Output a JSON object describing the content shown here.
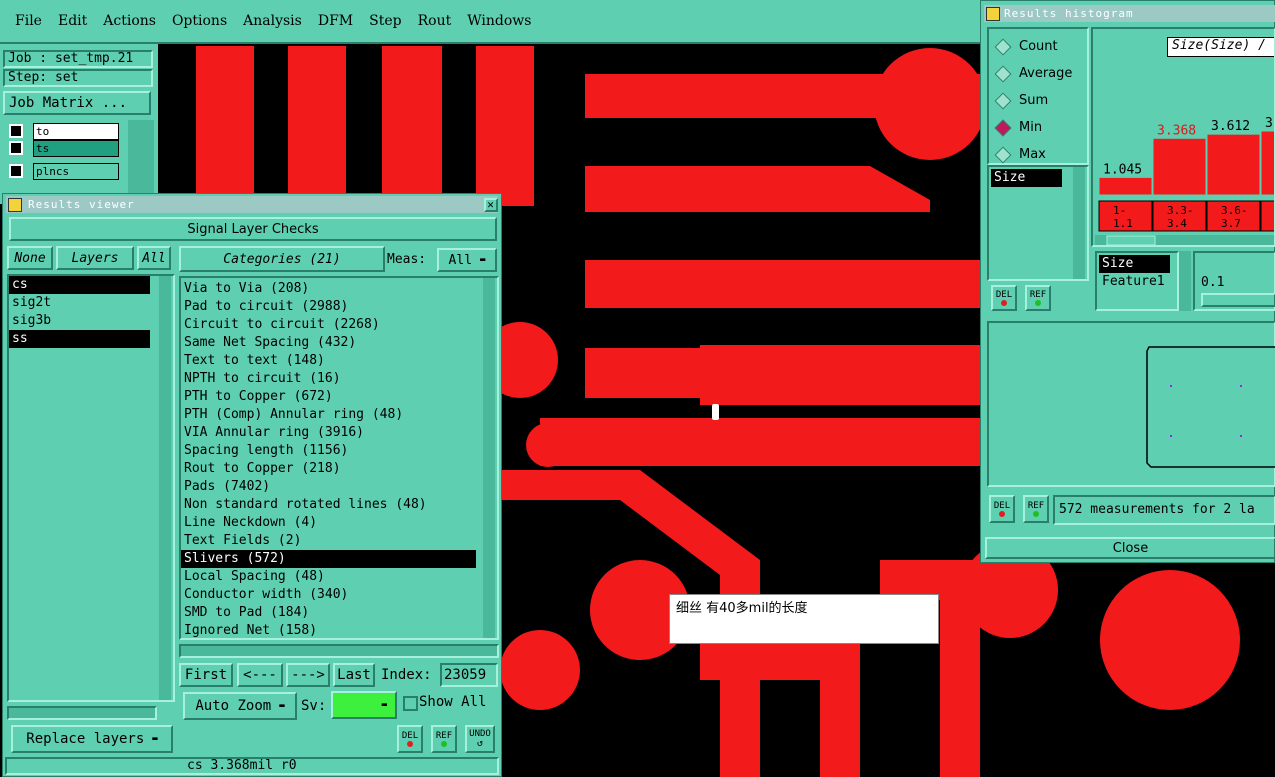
{
  "menu": [
    "File",
    "Edit",
    "Actions",
    "Options",
    "Analysis",
    "DFM",
    "Step",
    "Rout",
    "Windows"
  ],
  "job": {
    "job_label": "Job : set_tmp.21",
    "step_label": "Step: set",
    "matrix_button": "Job Matrix ..."
  },
  "layer_list": [
    {
      "name": "to",
      "color": "#ffffff"
    },
    {
      "name": "ts",
      "color": "#20a080"
    },
    {
      "name": "plncs",
      "color": "#5ecfb0"
    },
    {
      "name": "ss",
      "color": "#ffcc80"
    }
  ],
  "results_viewer": {
    "title": "Results viewer",
    "signal_checks": "Signal Layer Checks",
    "none_btn": "None",
    "layers_btn": "Layers",
    "all_btn": "All",
    "layers": [
      {
        "name": "cs",
        "selected": true
      },
      {
        "name": "sig2t",
        "selected": false
      },
      {
        "name": "sig3b",
        "selected": false
      },
      {
        "name": "ss",
        "selected": true
      }
    ],
    "categories_btn": "Categories (21)",
    "meas_label": "Meas:",
    "meas_value": "All",
    "categories": [
      {
        "label": "Via to Via (208)",
        "selected": false
      },
      {
        "label": "Pad to circuit (2988)",
        "selected": false
      },
      {
        "label": "Circuit to circuit (2268)",
        "selected": false
      },
      {
        "label": "Same Net Spacing (432)",
        "selected": false
      },
      {
        "label": "Text to text (148)",
        "selected": false
      },
      {
        "label": "NPTH to circuit (16)",
        "selected": false
      },
      {
        "label": "PTH to Copper (672)",
        "selected": false
      },
      {
        "label": "PTH (Comp) Annular ring (48)",
        "selected": false
      },
      {
        "label": "VIA Annular ring (3916)",
        "selected": false
      },
      {
        "label": "Spacing length (1156)",
        "selected": false
      },
      {
        "label": "Rout to Copper (218)",
        "selected": false
      },
      {
        "label": "Pads (7402)",
        "selected": false
      },
      {
        "label": "Non standard rotated lines (48)",
        "selected": false
      },
      {
        "label": "Line Neckdown (4)",
        "selected": false
      },
      {
        "label": "Text Fields (2)",
        "selected": false
      },
      {
        "label": "Slivers (572)",
        "selected": true
      },
      {
        "label": "Local Spacing (48)",
        "selected": false
      },
      {
        "label": "Conductor width (340)",
        "selected": false
      },
      {
        "label": "SMD to Pad (184)",
        "selected": false
      },
      {
        "label": "Ignored Net (158)",
        "selected": false
      }
    ],
    "first_btn": "First",
    "prev_btn": "<---",
    "next_btn": "--->",
    "last_btn": "Last",
    "index_label": "Index:",
    "index_value": "23059",
    "auto_zoom": "Auto Zoom",
    "sv_label": "Sv:",
    "show_all": "Show All",
    "replace_layers": "Replace layers",
    "del": "DEL",
    "ref": "REF",
    "undo": "UNDO",
    "status": "cs 3.368mil  r0"
  },
  "histogram": {
    "title": "Results histogram",
    "radios": [
      {
        "label": "Count",
        "on": false
      },
      {
        "label": "Average",
        "on": false
      },
      {
        "label": "Sum",
        "on": false
      },
      {
        "label": "Min",
        "on": true
      },
      {
        "label": "Max",
        "on": false
      }
    ],
    "size_list_top": "Size",
    "chart_title": "Size(Size) /",
    "size_list": [
      {
        "label": "Size",
        "selected": true
      },
      {
        "label": "Feature1",
        "selected": false
      }
    ],
    "threshold": "0.1",
    "del": "DEL",
    "ref": "REF",
    "summary": "572 measurements for 2 la",
    "close": "Close"
  },
  "chart_data": {
    "type": "bar",
    "title": "Size(Size) /",
    "categories": [
      "1-\n1.1",
      "3.3-\n3.4",
      "3.6-\n3.7",
      "3"
    ],
    "values": [
      1.045,
      3.368,
      3.612,
      3.8
    ],
    "labels": [
      "1.045",
      "3.368",
      "3.612",
      "3"
    ],
    "highlight_index": 1,
    "highlight_color": "#d61b1b",
    "bar_color": "#f21a1a"
  },
  "annotation": "细丝  有40多mil的长度",
  "colors": {
    "copper": "#f21a1a",
    "background": "#000000",
    "panel": "#5ecfb0"
  }
}
